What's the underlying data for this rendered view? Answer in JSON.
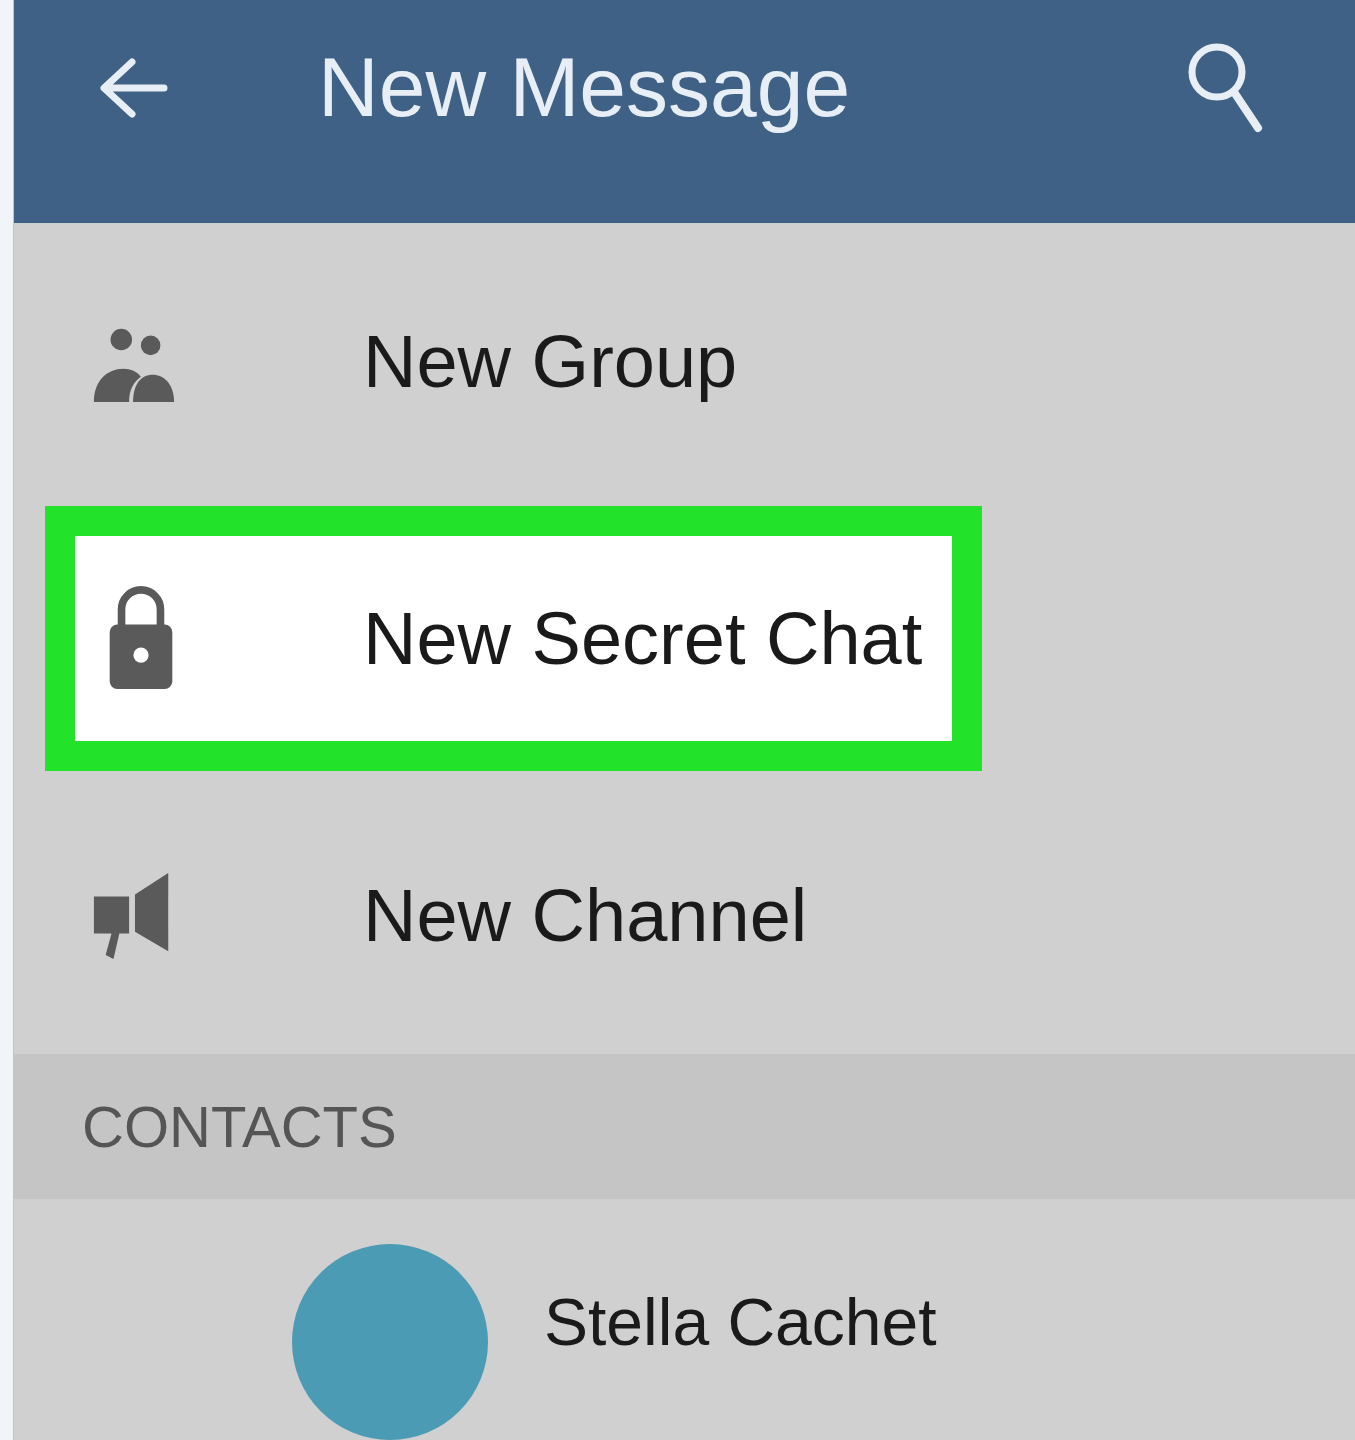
{
  "header": {
    "title": "New Message"
  },
  "menu_items": [
    {
      "kind": "group",
      "label": "New Group",
      "highlighted": false
    },
    {
      "kind": "lock",
      "label": "New Secret Chat",
      "highlighted": true
    },
    {
      "kind": "channel",
      "label": "New Channel",
      "highlighted": false
    }
  ],
  "contacts": {
    "heading": "CONTACTS",
    "items": [
      {
        "name": "Stella Cachet"
      }
    ]
  }
}
